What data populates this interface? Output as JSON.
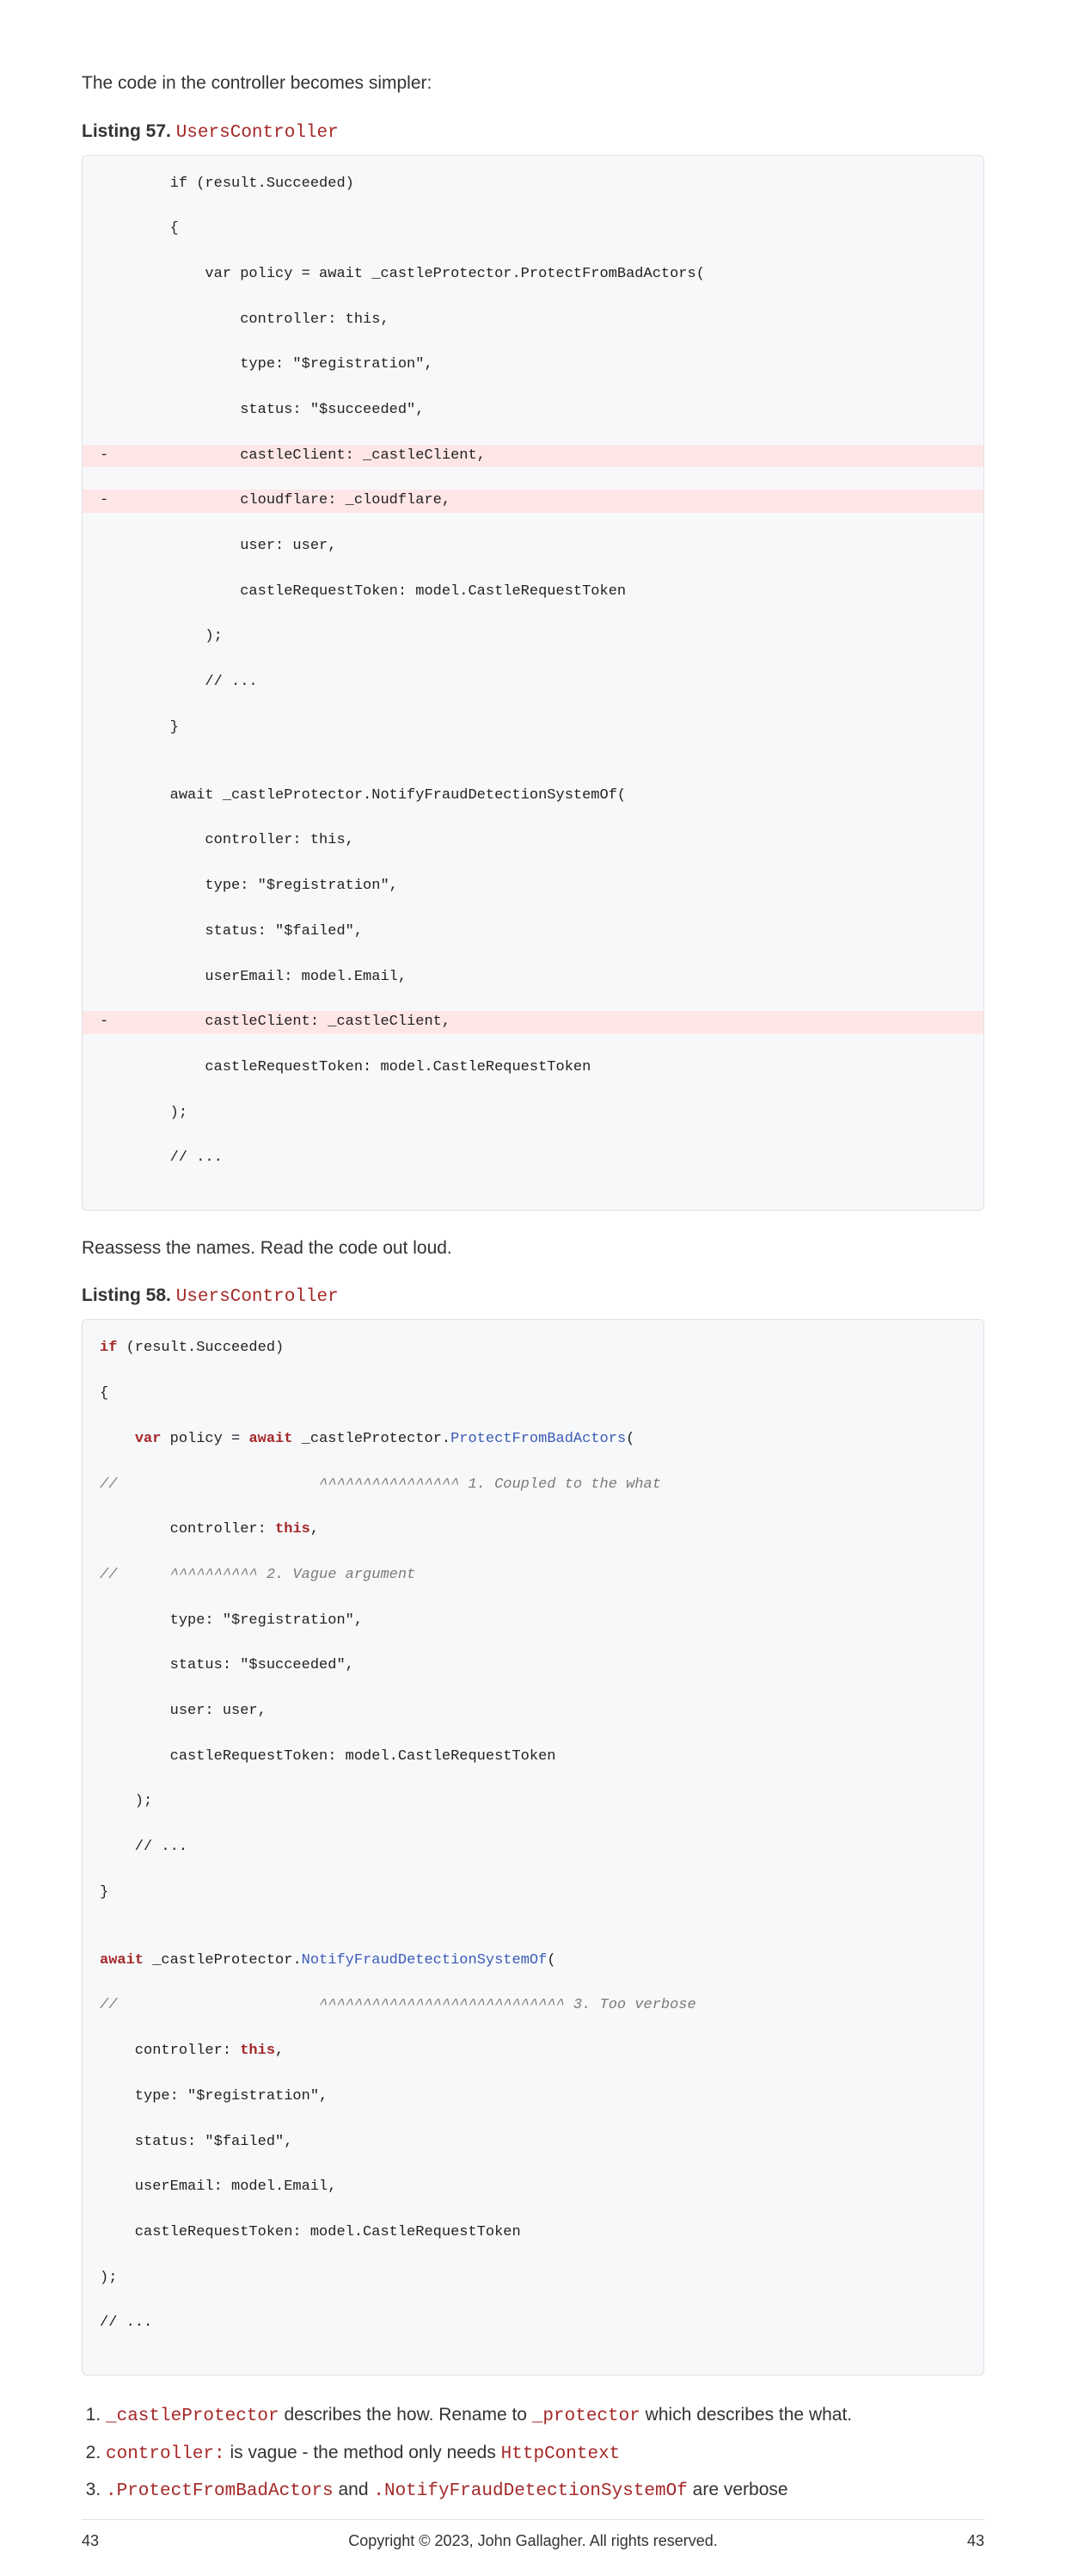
{
  "intro": "The code in the controller becomes simpler:",
  "listing57": {
    "label": "Listing 57.",
    "title": "UsersController",
    "lines": [
      {
        "t": "        if (result.Succeeded)"
      },
      {
        "t": "        {"
      },
      {
        "t": "            var policy = await _castleProtector.ProtectFromBadActors("
      },
      {
        "t": "                controller: this,"
      },
      {
        "t": "                type: \"$registration\","
      },
      {
        "t": "                status: \"$succeeded\","
      },
      {
        "t": "-               castleClient: _castleClient,",
        "del": true
      },
      {
        "t": "-               cloudflare: _cloudflare,",
        "del": true
      },
      {
        "t": "                user: user,"
      },
      {
        "t": "                castleRequestToken: model.CastleRequestToken"
      },
      {
        "t": "            );"
      },
      {
        "t": "            // ..."
      },
      {
        "t": "        }"
      },
      {
        "t": ""
      },
      {
        "t": "        await _castleProtector.NotifyFraudDetectionSystemOf("
      },
      {
        "t": "            controller: this,"
      },
      {
        "t": "            type: \"$registration\","
      },
      {
        "t": "            status: \"$failed\","
      },
      {
        "t": "            userEmail: model.Email,"
      },
      {
        "t": "-           castleClient: _castleClient,",
        "del": true
      },
      {
        "t": "            castleRequestToken: model.CastleRequestToken"
      },
      {
        "t": "        );"
      },
      {
        "t": "        // ..."
      }
    ]
  },
  "reassess": "Reassess the names. Read the code out loud.",
  "listing58": {
    "label": "Listing 58.",
    "title": "UsersController",
    "lines": [
      {
        "parts": [
          {
            "kw": "if"
          },
          {
            "t": " (result.Succeeded)"
          }
        ]
      },
      {
        "parts": [
          {
            "t": "{"
          }
        ]
      },
      {
        "parts": [
          {
            "t": "    "
          },
          {
            "kw": "var"
          },
          {
            "t": " policy = "
          },
          {
            "kw": "await"
          },
          {
            "t": " _castleProtector."
          },
          {
            "fn": "ProtectFromBadActors"
          },
          {
            "t": "("
          }
        ]
      },
      {
        "parts": [
          {
            "comment": "//                       ^^^^^^^^^^^^^^^^ 1. Coupled to the what"
          }
        ]
      },
      {
        "parts": [
          {
            "t": "        controller: "
          },
          {
            "kw": "this"
          },
          {
            "t": ","
          }
        ]
      },
      {
        "parts": [
          {
            "comment": "//      ^^^^^^^^^^ 2. Vague argument"
          }
        ]
      },
      {
        "parts": [
          {
            "t": "        type: \"$registration\","
          }
        ]
      },
      {
        "parts": [
          {
            "t": "        status: \"$succeeded\","
          }
        ]
      },
      {
        "parts": [
          {
            "t": "        user: user,"
          }
        ]
      },
      {
        "parts": [
          {
            "t": "        castleRequestToken: model.CastleRequestToken"
          }
        ]
      },
      {
        "parts": [
          {
            "t": "    );"
          }
        ]
      },
      {
        "parts": [
          {
            "t": "    // ..."
          }
        ]
      },
      {
        "parts": [
          {
            "t": "}"
          }
        ]
      },
      {
        "parts": [
          {
            "t": ""
          }
        ]
      },
      {
        "parts": [
          {
            "kw": "await"
          },
          {
            "t": " _castleProtector."
          },
          {
            "fn": "NotifyFraudDetectionSystemOf"
          },
          {
            "t": "("
          }
        ]
      },
      {
        "parts": [
          {
            "comment": "//                       ^^^^^^^^^^^^^^^^^^^^^^^^^^^^ 3. Too verbose"
          }
        ]
      },
      {
        "parts": [
          {
            "t": "    controller: "
          },
          {
            "kw": "this"
          },
          {
            "t": ","
          }
        ]
      },
      {
        "parts": [
          {
            "t": "    type: \"$registration\","
          }
        ]
      },
      {
        "parts": [
          {
            "t": "    status: \"$failed\","
          }
        ]
      },
      {
        "parts": [
          {
            "t": "    userEmail: model.Email,"
          }
        ]
      },
      {
        "parts": [
          {
            "t": "    castleRequestToken: model.CastleRequestToken"
          }
        ]
      },
      {
        "parts": [
          {
            "t": ");"
          }
        ]
      },
      {
        "parts": [
          {
            "t": "// ..."
          }
        ]
      }
    ]
  },
  "notes": {
    "n1a": "_castleProtector",
    "n1b": " describes the how. Rename to ",
    "n1c": "_protector",
    "n1d": " which describes the what.",
    "n2a": "controller:",
    "n2b": " is vague - the method only needs ",
    "n2c": "HttpContext",
    "n3a": ".ProtectFromBadActors",
    "n3b": " and ",
    "n3c": ".NotifyFraudDetectionSystemOf",
    "n3d": " are verbose"
  },
  "footer": {
    "left": "43",
    "center": "Copyright © 2023, John Gallagher. All rights reserved.",
    "right": "43"
  }
}
